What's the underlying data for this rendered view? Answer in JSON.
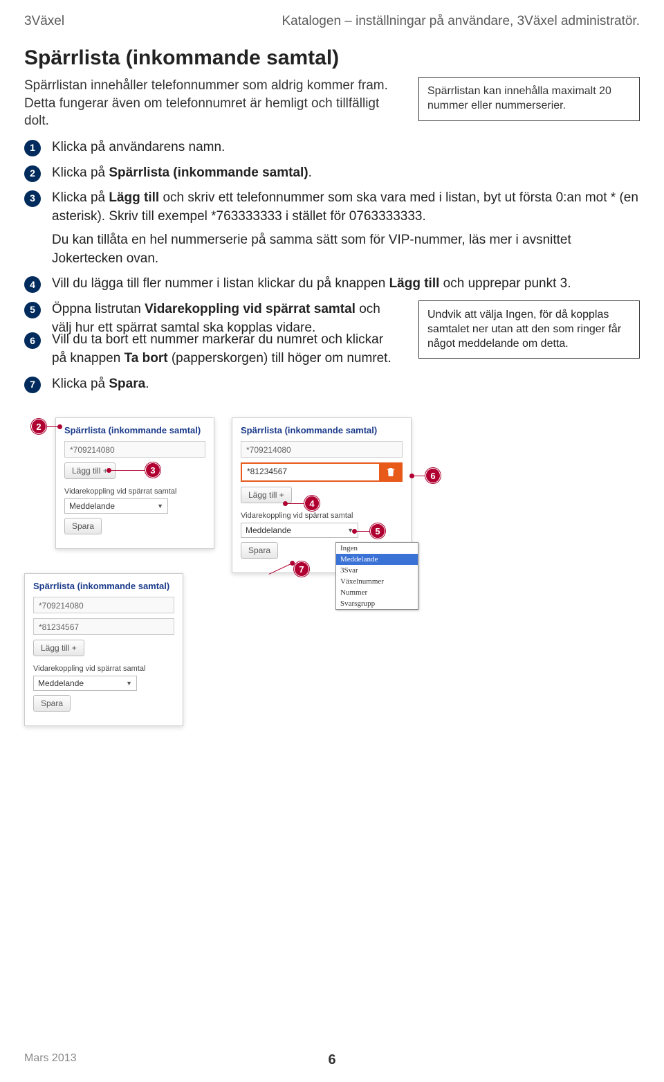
{
  "header": {
    "left": "3Växel",
    "right": "Katalogen – inställningar på användare, 3Växel administratör."
  },
  "title": "Spärrlista (inkommande samtal)",
  "intro": "Spärrlistan innehåller telefonnummer som aldrig kommer fram. Detta fungerar även om telefonnumret är hemligt och tillfälligt dolt.",
  "sidebox1": "Spärrlistan kan innehålla maximalt 20 nummer eller nummerserier.",
  "steps": {
    "s1": "Klicka på användarens namn.",
    "s2_a": "Klicka på ",
    "s2_b": "Spärrlista (inkommande samtal)",
    "s2_c": ".",
    "s3_a": "Klicka på ",
    "s3_b": "Lägg till",
    "s3_c": " och skriv ett telefonnummer som ska vara med i listan, byt ut första 0:an mot * (en asterisk). Skriv till exempel *763333333 i stället för 0763333333.",
    "s3_para": "Du kan tillåta en hel nummerserie på samma sätt som för VIP-nummer, läs mer i avsnittet Jokertecken ovan.",
    "s4_a": "Vill du lägga till fler nummer i listan klickar du på knappen ",
    "s4_b": "Lägg till",
    "s4_c": " och upprepar punkt 3.",
    "s5_a": "Öppna listrutan ",
    "s5_b": "Vidarekoppling vid spärrat samtal",
    "s5_c": " och välj hur ett spärrat samtal ska kopplas vidare.",
    "s6_a": "Vill du ta bort ett nummer markerar du numret och klickar på knappen ",
    "s6_b": "Ta bort",
    "s6_c": " (papperskorgen) till höger om numret.",
    "s7_a": "Klicka på ",
    "s7_b": "Spara",
    "s7_c": "."
  },
  "sidebox2": "Undvik att välja Ingen, för då kopplas samtalet ner utan att den som ringer får något meddelande om detta.",
  "panelA": {
    "title": "Spärrlista (inkommande samtal)",
    "num1": "*709214080",
    "add": "Lägg till +",
    "fwdlabel": "Vidarekoppling vid spärrat samtal",
    "fwdval": "Meddelande",
    "save": "Spara"
  },
  "panelB": {
    "title": "Spärrlista (inkommande samtal)",
    "num1": "*709214080",
    "num2": "*81234567",
    "add": "Lägg till +",
    "fwdlabel": "Vidarekoppling vid spärrat samtal",
    "fwdval": "Meddelande",
    "save": "Spara"
  },
  "panelC": {
    "title": "Spärrlista (inkommande samtal)",
    "num1": "*709214080",
    "num2": "*81234567",
    "add": "Lägg till +",
    "fwdlabel": "Vidarekoppling vid spärrat samtal",
    "fwdval": "Meddelande",
    "save": "Spara"
  },
  "dropdown": {
    "opt1": "Ingen",
    "opt2": "Meddelande",
    "opt3": "3Svar",
    "opt4": "Växelnummer",
    "opt5": "Nummer",
    "opt6": "Svarsgrupp"
  },
  "footer": {
    "date": "Mars 2013",
    "page": "6"
  }
}
